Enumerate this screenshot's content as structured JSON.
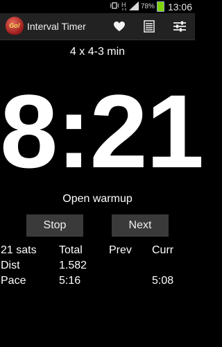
{
  "status_bar": {
    "battery_percent": "78%",
    "time": "13:06",
    "icons": [
      "mute-vibrate-icon",
      "data-h-icon",
      "signal-icon",
      "battery-icon"
    ]
  },
  "action_bar": {
    "logo_text": "Go!",
    "title": "Interval Timer",
    "icons": [
      "heart-icon",
      "list-icon",
      "settings-sliders-icon"
    ]
  },
  "workout_name": "4 x 4-3 min",
  "timer": "8:21",
  "phase": "Open warmup",
  "buttons": {
    "stop": "Stop",
    "next": "Next"
  },
  "stats": {
    "header": [
      "21 sats",
      "Total",
      "Prev",
      "Curr"
    ],
    "rows": [
      [
        "Dist",
        "1.582",
        "",
        ""
      ],
      [
        "Pace",
        "5:16",
        "",
        "5:08"
      ]
    ]
  }
}
